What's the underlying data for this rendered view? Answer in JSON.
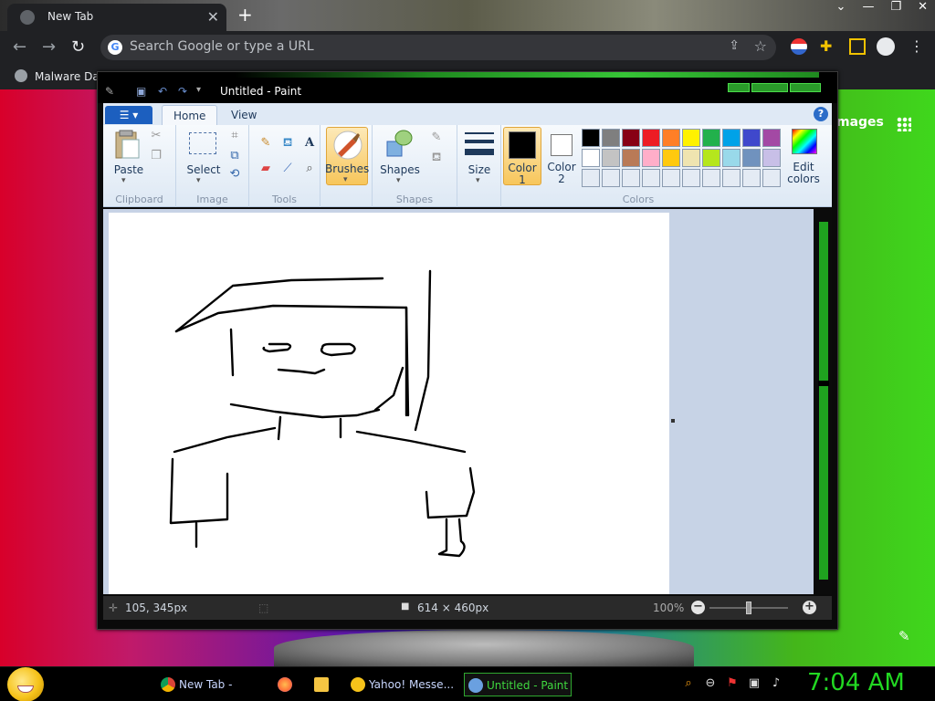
{
  "browser": {
    "tab_title": "New Tab",
    "tab_close": "✕",
    "new_tab": "+",
    "window_controls": [
      "⌄",
      "—",
      "❐",
      "✕"
    ],
    "omnibox_placeholder": "Search Google or type a URL",
    "bookmark_label": "Malware Dat",
    "images_link": "mages"
  },
  "paint": {
    "title": "Untitled - Paint",
    "tabs": {
      "home": "Home",
      "view": "View"
    },
    "help": "?",
    "groups": {
      "clipboard": {
        "label": "Clipboard",
        "paste": "Paste"
      },
      "image": {
        "label": "Image",
        "select": "Select"
      },
      "tools": {
        "label": "Tools"
      },
      "brushes": "Brushes",
      "shapes": {
        "label": "Shapes",
        "button": "Shapes"
      },
      "size": "Size",
      "colors": {
        "label": "Colors",
        "color1": "Color\n1",
        "color2": "Color\n2",
        "edit": "Edit\ncolors"
      }
    },
    "palette": [
      "#000000",
      "#7f7f7f",
      "#880015",
      "#ed1c24",
      "#ff7f27",
      "#fff200",
      "#22b14c",
      "#00a2e8",
      "#3f48cc",
      "#a349a4",
      "#ffffff",
      "#c3c3c3",
      "#b97a57",
      "#ffaec9",
      "#ffc90e",
      "#efe4b0",
      "#b5e61d",
      "#99d9ea",
      "#7092be",
      "#c8bfe7",
      "#e4ebf4",
      "#e4ebf4",
      "#e4ebf4",
      "#e4ebf4",
      "#e4ebf4",
      "#e4ebf4",
      "#e4ebf4",
      "#e4ebf4",
      "#e4ebf4",
      "#e4ebf4"
    ],
    "color1": "#000000",
    "color2": "#ffffff",
    "status": {
      "cursor_position": "105, 345px",
      "canvas_size": "614 × 460px",
      "zoom": "100%"
    }
  },
  "taskbar": {
    "tasks": [
      {
        "label": "New Tab - Goo...",
        "icon_color": "#dd4b39"
      },
      {
        "label": "",
        "icon_color": "#ff7139"
      },
      {
        "label": "",
        "icon_color": "#f5c542"
      },
      {
        "label": "Yahoo! Messe...",
        "icon_color": "#f6c31a"
      },
      {
        "label": "Untitled - Paint",
        "icon_color": "#6aa0e0"
      }
    ],
    "clock": "7:04 AM"
  }
}
